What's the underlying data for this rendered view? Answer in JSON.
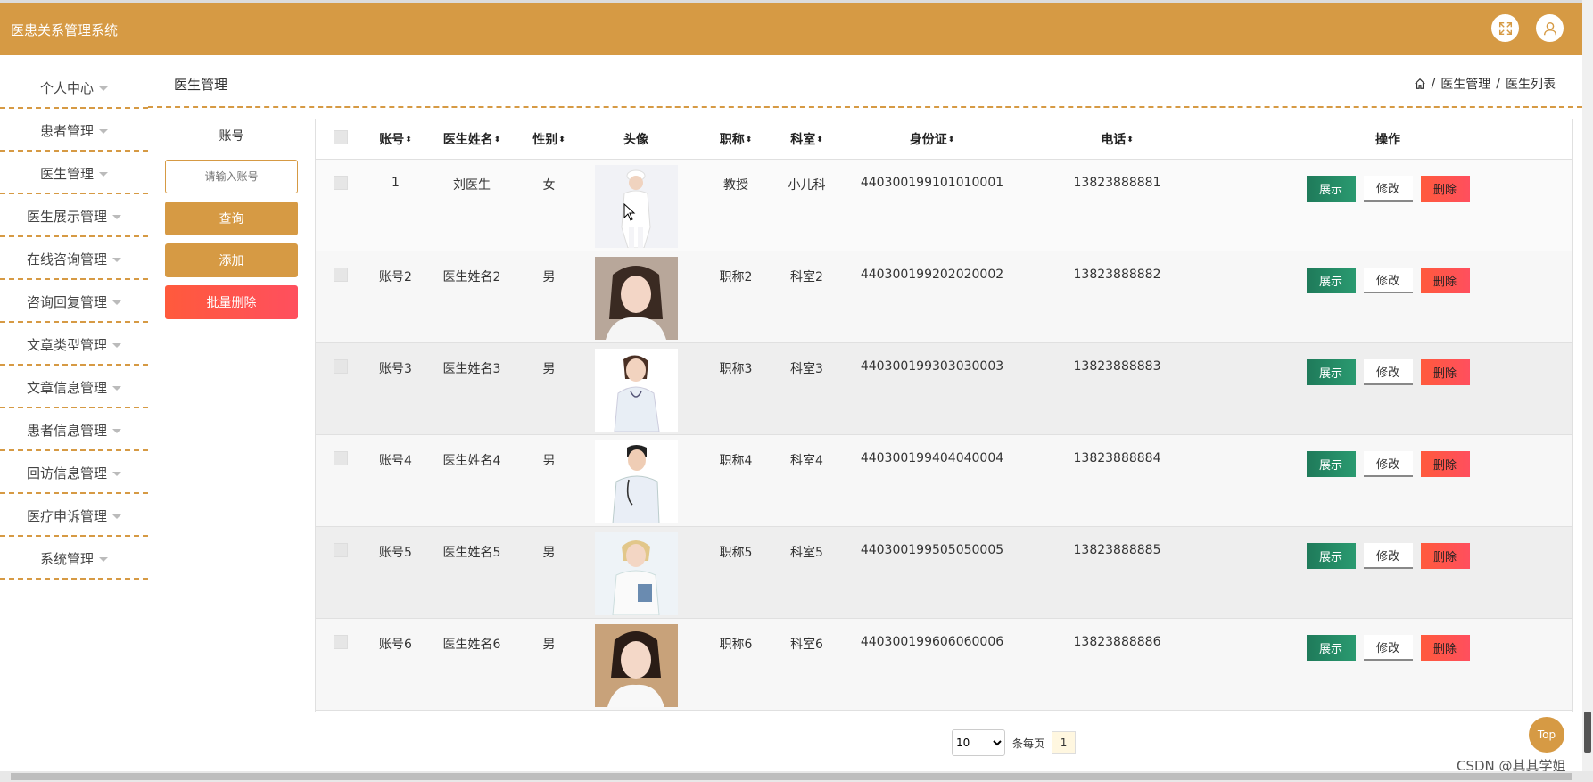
{
  "app": {
    "title": "医患关系管理系统"
  },
  "header_icons": {
    "fullscreen": "expand-icon",
    "user": "user-icon"
  },
  "sidebar": {
    "items": [
      {
        "label": "个人中心"
      },
      {
        "label": "患者管理"
      },
      {
        "label": "医生管理"
      },
      {
        "label": "医生展示管理"
      },
      {
        "label": "在线咨询管理"
      },
      {
        "label": "咨询回复管理"
      },
      {
        "label": "文章类型管理"
      },
      {
        "label": "文章信息管理"
      },
      {
        "label": "患者信息管理"
      },
      {
        "label": "回访信息管理"
      },
      {
        "label": "医疗申诉管理"
      },
      {
        "label": "系统管理"
      }
    ]
  },
  "page": {
    "title": "医生管理",
    "breadcrumb": [
      "医生管理",
      "医生列表"
    ],
    "breadcrumb_sep": "/"
  },
  "search": {
    "label": "账号",
    "placeholder": "请输入账号",
    "query_label": "查询",
    "add_label": "添加",
    "batch_delete_label": "批量删除"
  },
  "table": {
    "headers": [
      "账号",
      "医生姓名",
      "性别",
      "头像",
      "职称",
      "科室",
      "身份证",
      "电话",
      "操作"
    ],
    "sort_glyph": "⬍",
    "rows": [
      {
        "account": "1",
        "name": "刘医生",
        "gender": "女",
        "title": "教授",
        "dept": "小儿科",
        "id_card": "440300199101010001",
        "phone": "13823888881"
      },
      {
        "account": "账号2",
        "name": "医生姓名2",
        "gender": "男",
        "title": "职称2",
        "dept": "科室2",
        "id_card": "440300199202020002",
        "phone": "13823888882"
      },
      {
        "account": "账号3",
        "name": "医生姓名3",
        "gender": "男",
        "title": "职称3",
        "dept": "科室3",
        "id_card": "440300199303030003",
        "phone": "13823888883"
      },
      {
        "account": "账号4",
        "name": "医生姓名4",
        "gender": "男",
        "title": "职称4",
        "dept": "科室4",
        "id_card": "440300199404040004",
        "phone": "13823888884"
      },
      {
        "account": "账号5",
        "name": "医生姓名5",
        "gender": "男",
        "title": "职称5",
        "dept": "科室5",
        "id_card": "440300199505050005",
        "phone": "13823888885"
      },
      {
        "account": "账号6",
        "name": "医生姓名6",
        "gender": "男",
        "title": "职称6",
        "dept": "科室6",
        "id_card": "440300199606060006",
        "phone": "13823888886"
      }
    ],
    "ops": {
      "show": "展示",
      "edit": "修改",
      "delete": "删除"
    }
  },
  "pager": {
    "page_size": "10",
    "per_page_label": "条每页",
    "current_page": "1"
  },
  "top_button": "Top",
  "watermark": "CSDN @其其学姐",
  "colors": {
    "accent": "#d69a44",
    "danger": "#ff5a3c",
    "success": "#1f7a5a"
  }
}
